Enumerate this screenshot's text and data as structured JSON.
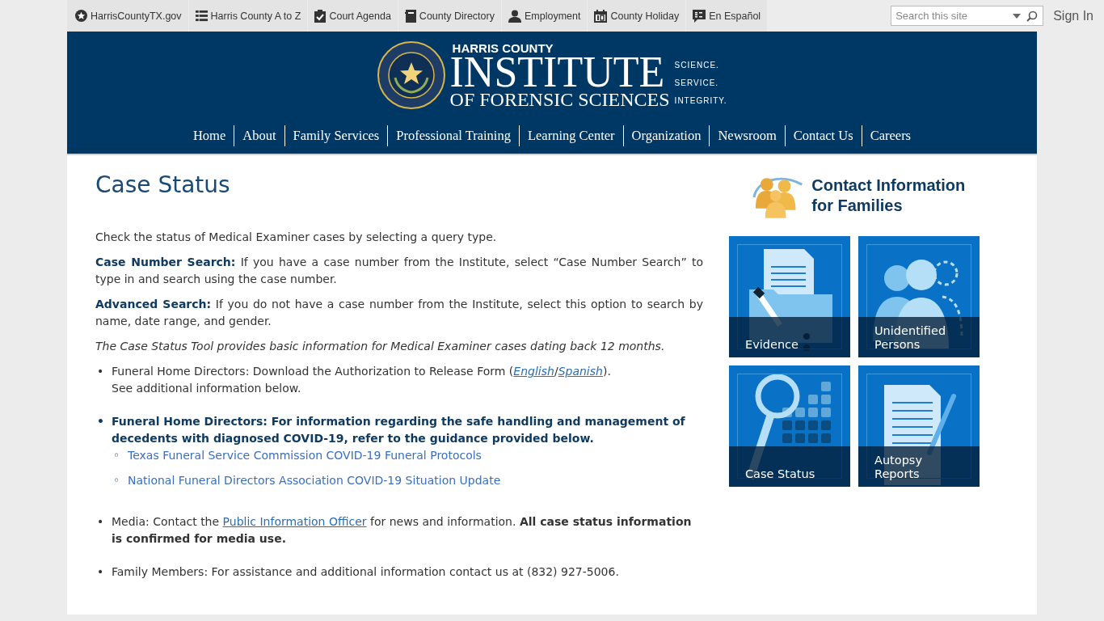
{
  "top_links": [
    {
      "label": "HarrisCountyTX.gov",
      "kind": "star"
    },
    {
      "label": "Harris County A to Z",
      "kind": "list"
    },
    {
      "label": "Court Agenda",
      "kind": "clipboard"
    },
    {
      "label": "County Directory",
      "kind": "book"
    },
    {
      "label": "Employment",
      "kind": "person"
    },
    {
      "label": "County Holiday",
      "kind": "calendar"
    },
    {
      "label": "En Español",
      "kind": "language"
    }
  ],
  "search": {
    "placeholder": "Search this site"
  },
  "sign_in": "Sign In",
  "header": {
    "org": "HARRIS COUNTY",
    "title": "INSTITUTE",
    "subtitle": "OF FORENSIC SCIENCES",
    "mottos": [
      "SCIENCE.",
      "SERVICE.",
      "INTEGRITY."
    ]
  },
  "nav": [
    "Home",
    "About",
    "Family Services",
    "Professional Training",
    "Learning Center",
    "Organization",
    "Newsroom",
    "Contact Us",
    "Careers"
  ],
  "page": {
    "title": "Case Status",
    "paragraphs": [
      {
        "kind": "plain",
        "text": "Check the status of Medical Examiner cases by selecting a query type."
      },
      {
        "kind": "plain",
        "text": "**Case Number Search:** If you have a case number from the Institute, select “Case Number Search” to type in and search using the case number."
      },
      {
        "kind": "plain",
        "text": "**Advanced Search:** If you do not have a case number from the Institute, select this option to search by name, date range, and gender."
      },
      {
        "kind": "note",
        "text": "The Case Status Tool provides basic information for Medical Examiner cases dating back 12 months."
      }
    ],
    "bullets": [
      {
        "marker": "•",
        "bold": false,
        "parts": [
          {
            "kind": "text",
            "text": "Funeral Home Directors: Download the Authorization to Release Form ("
          },
          {
            "kind": "link",
            "text": "English"
          },
          {
            "kind": "text",
            "text": "/"
          },
          {
            "kind": "link",
            "text": "Spanish"
          },
          {
            "kind": "text",
            "text": ")."
          }
        ],
        "line2": "See additional information below."
      },
      {
        "marker": "•",
        "bold": true,
        "parts": [
          {
            "kind": "text",
            "text": "Funeral Home Directors: For information regarding the safe handling and management of decedents with diagnosed COVID-19, refer to the guidance provided below."
          }
        ],
        "children": [
          {
            "marker": "◦",
            "text": "Texas Funeral Service Commission COVID-19 Funeral Protocols"
          },
          {
            "marker": "◦",
            "text": "National Funeral Directors Association COVID-19 Situation Update"
          }
        ]
      },
      {
        "marker": "•",
        "bold": false,
        "parts": [
          {
            "kind": "text",
            "text": "Media: Contact the "
          },
          {
            "kind": "link",
            "text": "Public Information Officer"
          },
          {
            "kind": "text",
            "text": " for news and information. **All case status information is confirmed for media use.**"
          }
        ]
      },
      {
        "marker": "•",
        "bold": false,
        "parts": [
          {
            "kind": "text",
            "text": "Family Members: For assistance and additional information contact us at (832) 927-5006."
          }
        ]
      }
    ]
  },
  "sidebar": {
    "banner": "Contact Information for Families",
    "tiles": [
      {
        "label": "Evidence",
        "kind": "evidence"
      },
      {
        "label": "Unidentified Persons",
        "kind": "persons"
      },
      {
        "label": "Case Status",
        "kind": "search"
      },
      {
        "label": "Autopsy Reports",
        "kind": "report"
      }
    ]
  }
}
